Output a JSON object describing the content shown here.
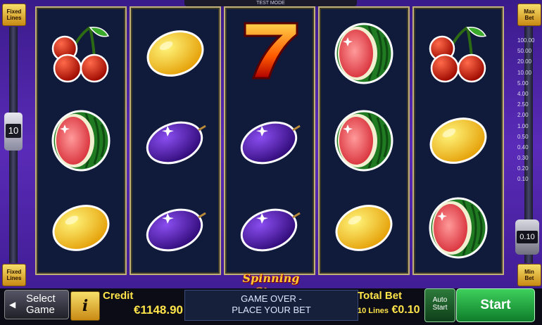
{
  "top_bar": {
    "label": "TEST MODE"
  },
  "left_panel": {
    "fixed_lines_top": "Fixed\nLines",
    "fixed_lines_bottom": "Fixed\nLines",
    "lines_value": "10"
  },
  "right_panel": {
    "max_bet_label": "Max\nBet",
    "min_bet_label": "Min\nBet",
    "bet_value": "0.10",
    "scale": [
      "100.00",
      "50.00",
      "20.00",
      "10.00",
      "5.00",
      "4.00",
      "2.50",
      "2.00",
      "1.00",
      "0.50",
      "0.40",
      "0.30",
      "0.20",
      "0.10"
    ]
  },
  "game": {
    "logo": "Spinning Stars",
    "reels": [
      [
        "cherry",
        "watermelon",
        "lemon"
      ],
      [
        "lemon",
        "plum",
        "plum"
      ],
      [
        "seven",
        "plum",
        "plum"
      ],
      [
        "watermelon",
        "watermelon",
        "lemon"
      ],
      [
        "cherry",
        "lemon",
        "watermelon"
      ]
    ]
  },
  "bottom_bar": {
    "select_game": {
      "line1": "Select",
      "line2": "Game"
    },
    "info_label": "i",
    "credit": {
      "label": "Credit",
      "value": "€1148.90"
    },
    "message": {
      "line1": "GAME OVER -",
      "line2": "PLACE YOUR BET"
    },
    "total_bet": {
      "label": "Total Bet",
      "lines_text": "10 Lines",
      "value": "€0.10"
    },
    "auto_start": {
      "line1": "Auto",
      "line2": "Start"
    },
    "start_label": "Start"
  },
  "colors": {
    "accent": "#ffe44a",
    "background": "#4a22a4",
    "reel_bg": "#101a3a"
  },
  "icons": [
    "arrow-left-icon",
    "info-icon",
    "cherry-icon",
    "lemon-icon",
    "plum-icon",
    "watermelon-icon",
    "seven-icon"
  ]
}
